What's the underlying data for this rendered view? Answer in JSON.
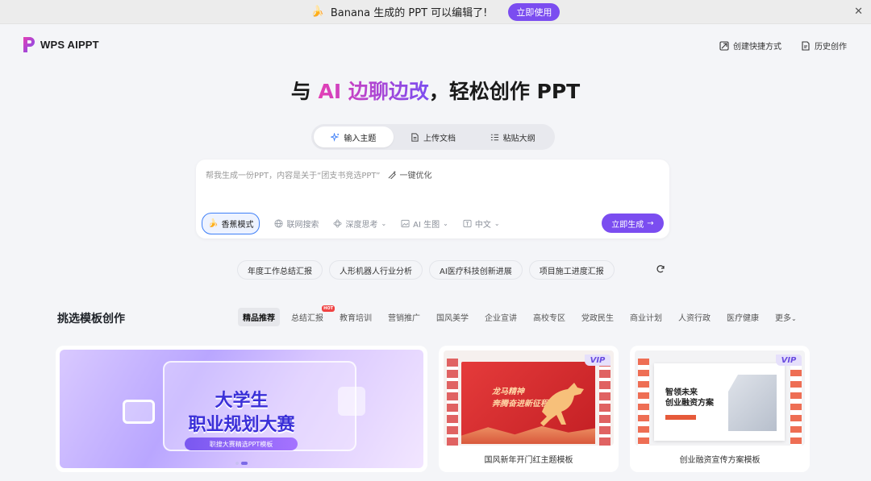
{
  "banner": {
    "emoji": "🍌",
    "message": "Banana 生成的 PPT 可以编辑了!",
    "cta": "立即使用",
    "close": "✕"
  },
  "brand": {
    "name": "WPS AIPPT",
    "accent": "#7b4df0"
  },
  "toplinks": {
    "shortcut": "创建快捷方式",
    "history": "历史创作"
  },
  "headline": {
    "prefix": "与 ",
    "highlight": "AI 边聊边改",
    "suffix": "，轻松创作 PPT"
  },
  "tabs": [
    {
      "label": "输入主题",
      "icon": "sparkle-icon"
    },
    {
      "label": "上传文档",
      "icon": "document-icon"
    },
    {
      "label": "粘贴大纲",
      "icon": "outline-icon"
    }
  ],
  "input": {
    "placeholder": "帮我生成一份PPT，内容是关于“团支书竞选PPT”",
    "optimize": "一键优化"
  },
  "tools": {
    "mode": "香蕉模式",
    "web": "联网搜索",
    "deep": "深度思考",
    "image": "AI 生图",
    "lang": "中文"
  },
  "generate": "立即生成",
  "chips": [
    "年度工作总结汇报",
    "人形机器人行业分析",
    "AI医疗科技创新进展",
    "项目施工进度汇报"
  ],
  "templates": {
    "title": "挑选模板创作",
    "categories": [
      "精品推荐",
      "总结汇报",
      "教育培训",
      "营销推广",
      "国风美学",
      "企业宣讲",
      "高校专区",
      "党政民生",
      "商业计划",
      "人资行政",
      "医疗健康"
    ],
    "hot": "HOT",
    "more": "更多",
    "featured": {
      "line1": "大学生",
      "line2": "职业规划大赛",
      "pill": "职搜大赛精选PPT模板"
    },
    "cards": [
      {
        "caption": "国风新年开门红主题模板",
        "badge": "VIP",
        "line1": "龙马精神",
        "line2": "奔腾奋进新征程"
      },
      {
        "caption": "创业融资宣传方案模板",
        "badge": "VIP",
        "line1": "智领未来",
        "line2": "创业融资方案"
      }
    ]
  }
}
